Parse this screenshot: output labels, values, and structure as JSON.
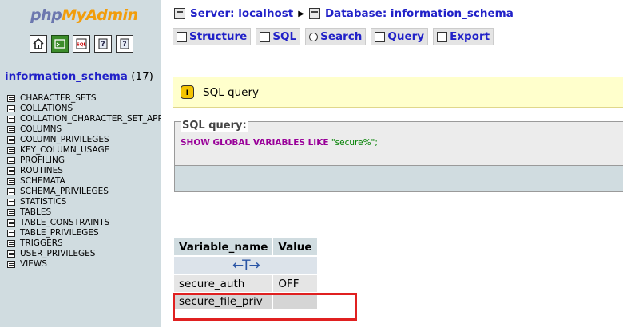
{
  "app": {
    "logo": {
      "php": "php",
      "my": "My",
      "admin": "Admin"
    }
  },
  "nav": {
    "icons": [
      "home-icon",
      "sql-window-icon",
      "sql-query-icon",
      "docs-icon",
      "help-icon"
    ],
    "database": {
      "name": "information_schema",
      "count": "(17)"
    },
    "tables": [
      "CHARACTER_SETS",
      "COLLATIONS",
      "COLLATION_CHARACTER_SET_APP",
      "COLUMNS",
      "COLUMN_PRIVILEGES",
      "KEY_COLUMN_USAGE",
      "PROFILING",
      "ROUTINES",
      "SCHEMATA",
      "SCHEMA_PRIVILEGES",
      "STATISTICS",
      "TABLES",
      "TABLE_CONSTRAINTS",
      "TABLE_PRIVILEGES",
      "TRIGGERS",
      "USER_PRIVILEGES",
      "VIEWS"
    ]
  },
  "breadcrumb": {
    "server": "Server: localhost",
    "database": "Database: information_schema"
  },
  "tabs": [
    {
      "label": "Structure",
      "icon": "structure-icon"
    },
    {
      "label": "SQL",
      "icon": "sql-icon"
    },
    {
      "label": "Search",
      "icon": "search-icon"
    },
    {
      "label": "Query",
      "icon": "query-icon"
    },
    {
      "label": "Export",
      "icon": "export-icon"
    }
  ],
  "notice": {
    "icon": "info-icon",
    "text": "SQL query"
  },
  "sql_box": {
    "legend": "SQL query:",
    "keyword": "SHOW GLOBAL VARIABLES LIKE",
    "string": "\"secure%\";"
  },
  "result": {
    "columns": [
      "Variable_name",
      "Value"
    ],
    "rows": [
      {
        "name": "secure_auth",
        "value": "OFF"
      },
      {
        "name": "secure_file_priv",
        "value": ""
      }
    ]
  },
  "colors": {
    "nav_bg": "#d0dce0",
    "link": "#2121c8",
    "notice_bg": "#ffffcc",
    "highlight": "#e02020"
  }
}
